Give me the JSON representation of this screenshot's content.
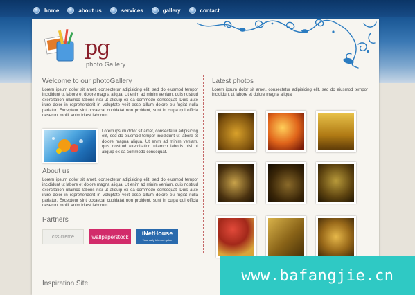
{
  "nav": {
    "items": [
      {
        "label": "home"
      },
      {
        "label": "about us"
      },
      {
        "label": "services"
      },
      {
        "label": "gallery"
      },
      {
        "label": "contact"
      }
    ]
  },
  "logo": {
    "mark": "pg",
    "subtitle": "photo Gallery"
  },
  "welcome": {
    "title": "Welcome to our photoGallery",
    "text": "Lorem ipsum dolor sit amet, consectetur adipisicing elit, sed do eiusmod tempor incididunt ut labore et dolore magna aliqua. Ut enim ad minim veniam, quis nostrud exercitation ullamco laboris nisi ut aliquip ex ea commodo consequat. Duis aute irure dolor in reprehenderit in voluptate velit esse cillum dolore eu fugiat nulla pariatur. Excepteur sint occaecat cupidatat non proident, sunt in culpa qui officia deserunt mollit anim id est laborum"
  },
  "feature": {
    "text": "Lorem ipsum dolor sit amet, consectetur adipisicing elit, sed do eiusmod tempor incididunt ut labore et dolore magna aliqua. Ut enim ad minim veniam, quis nostrud exercitation ullamco laboris nisi ut aliquip ex ea commodo consequat."
  },
  "about": {
    "title": "About us",
    "text": "Lorem ipsum dolor sit amet, consectetur adipisicing elit, sed do eiusmod tempor incididunt ut labore et dolore magna aliqua. Ut enim ad minim veniam, quis nostrud exercitation ullamco laboris nisi ut aliquip ex ea commodo consequat. Duis aute irure dolor in reprehenderit in voluptate velit esse cillum dolore eu fugiat nulla pariatur. Excepteur sint occaecat cupidatat non proident, sunt in culpa qui officia deserunt mollit anim id est laborum"
  },
  "partners": {
    "title": "Partners",
    "items": [
      {
        "label": "css creme"
      },
      {
        "label": "wallpaperstock"
      },
      {
        "label": "iNetHouse",
        "sub": "Your daily internet guide"
      }
    ]
  },
  "latest": {
    "title": "Latest photos",
    "text": "Lorem ipsum dolor sit amet, consectetur adipisicing elit, sed do eiusmod tempor incididunt ut labore et dolore magna aliqua."
  },
  "inspiration": {
    "title": "Inspiration Site"
  },
  "watermark": {
    "text": "www.bafangjie.cn"
  },
  "colors": {
    "accent": "#1f5fa0",
    "logo_red": "#8a1f2a",
    "divider": "#c56a6a",
    "watermark_bg": "#2fc9c4"
  }
}
